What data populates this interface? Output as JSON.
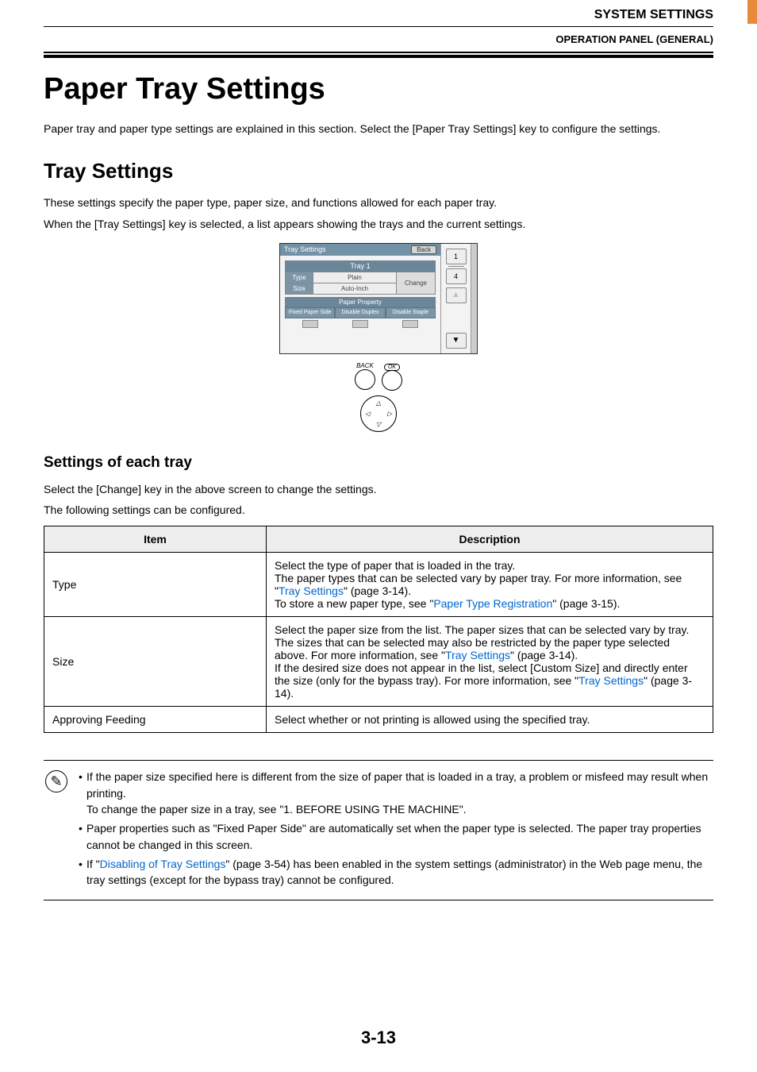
{
  "header": {
    "section": "SYSTEM SETTINGS",
    "subsection": "OPERATION PANEL (GENERAL)"
  },
  "h1": "Paper Tray Settings",
  "intro": "Paper tray and paper type settings are explained in this section. Select the [Paper Tray Settings] key to configure the settings.",
  "h2": "Tray Settings",
  "h2_p1": "These settings specify the paper type, paper size, and functions allowed for each paper tray.",
  "h2_p2": "When the [Tray Settings] key is selected, a list appears showing the trays and the current settings.",
  "screenshot": {
    "titlebar": "Tray Settings",
    "back": "Back",
    "tray": "Tray 1",
    "type_label": "Type",
    "type_val": "Plain",
    "size_label": "Size",
    "size_val": "Auto-Inch",
    "change": "Change",
    "paperprop": "Paper Property",
    "fixed": "Fixed Paper Side",
    "dis_dup": "Disable Duplex",
    "dis_stp": "Disable Staple",
    "page_cur": "1",
    "page_tot": "4",
    "back_btn": "BACK",
    "ok_btn": "OK"
  },
  "h3": "Settings of each tray",
  "h3_p1": "Select the [Change] key in the above screen to change the settings.",
  "h3_p2": "The following settings can be configured.",
  "table": {
    "head_item": "Item",
    "head_desc": "Description",
    "rows": [
      {
        "item": "Type",
        "d1": "Select the type of paper that is loaded in the tray.",
        "d2": "The paper types that can be selected vary by paper tray. For more information, see \"",
        "link1": "Tray Settings",
        "d3": "\" (page 3-14).",
        "d4": "To store a new paper type, see \"",
        "link2": "Paper Type Registration",
        "d5": "\" (page 3-15)."
      },
      {
        "item": "Size",
        "d1": "Select the paper size from the list. The paper sizes that can be selected vary by tray. The sizes that can be selected may also be restricted by the paper type selected above. For more information, see \"",
        "link1": "Tray Settings",
        "d2": "\" (page 3-14).",
        "d3": "If the desired size does not appear in the list, select [Custom Size] and directly enter the size (only for the bypass tray). For more information, see \"",
        "link2": "Tray Settings",
        "d4": "\" (page 3-14)."
      },
      {
        "item": "Approving Feeding",
        "d1": "Select whether or not printing is allowed using the specified tray."
      }
    ]
  },
  "notes": {
    "n1a": "If the paper size specified here is different from the size of paper that is loaded in a tray, a problem or misfeed may result when printing.",
    "n1b": "To change the paper size in a tray, see \"1. BEFORE USING THE MACHINE\".",
    "n2": "Paper properties such as \"Fixed Paper Side\" are automatically set when the paper type is selected. The paper tray properties cannot be changed in this screen.",
    "n3a": "If \"",
    "n3link": "Disabling of Tray Settings",
    "n3b": "\" (page 3-54) has been enabled in the system settings (administrator) in the Web page menu, the tray settings (except for the bypass tray) cannot be configured."
  },
  "pagenum": "3-13"
}
